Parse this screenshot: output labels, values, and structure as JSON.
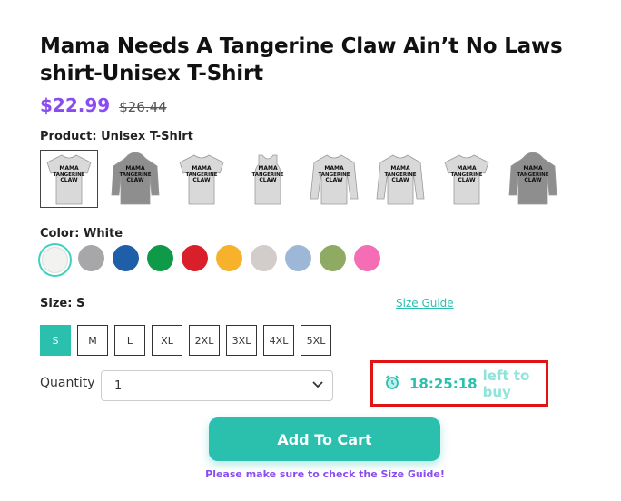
{
  "product": {
    "title": "Mama Needs A Tangerine Claw Ain’t No Laws shirt-Unisex T-Shirt",
    "price": "$22.99",
    "old_price": "$26.44"
  },
  "product_type": {
    "label": "Product:",
    "value": "Unisex T-Shirt",
    "options": [
      {
        "name": "Unisex T-Shirt",
        "icon": "tshirt-icon",
        "selected": true
      },
      {
        "name": "Hoodie",
        "icon": "hoodie-icon",
        "selected": false
      },
      {
        "name": "Women T-Shirt",
        "icon": "tshirt-icon",
        "selected": false
      },
      {
        "name": "Tank Top",
        "icon": "tank-icon",
        "selected": false
      },
      {
        "name": "Sweatshirt",
        "icon": "sweatshirt-icon",
        "selected": false
      },
      {
        "name": "Long Sleeve",
        "icon": "longsleeve-icon",
        "selected": false
      },
      {
        "name": "V-Neck",
        "icon": "tshirt-icon",
        "selected": false
      },
      {
        "name": "Hoodie Back",
        "icon": "hoodie-icon",
        "selected": false
      }
    ],
    "print_text": [
      "MAMA",
      "TANGERINE",
      "CLAW"
    ]
  },
  "color": {
    "label": "Color:",
    "value": "White",
    "swatches": [
      "#f2f2f0",
      "#a7a6a8",
      "#1f5ea8",
      "#0f9a4a",
      "#d81f2a",
      "#f7b22c",
      "#d2ccca",
      "#9db8d6",
      "#8fab63",
      "#f56db5"
    ]
  },
  "size": {
    "label": "Size:",
    "value": "S",
    "guide_link": "Size Guide",
    "options": [
      "S",
      "M",
      "L",
      "XL",
      "2XL",
      "3XL",
      "4XL",
      "5XL"
    ]
  },
  "quantity": {
    "label": "Quantity",
    "value": "1"
  },
  "timer": {
    "time": "18:25:18",
    "suffix": "left to buy",
    "icon": "alarm-clock-icon"
  },
  "cart": {
    "button_label": "Add To Cart",
    "note": "Please make sure to check the Size Guide!"
  },
  "colors": {
    "accent": "#2bbfae",
    "price": "#8a4cf0",
    "highlight_border": "#e01414"
  }
}
